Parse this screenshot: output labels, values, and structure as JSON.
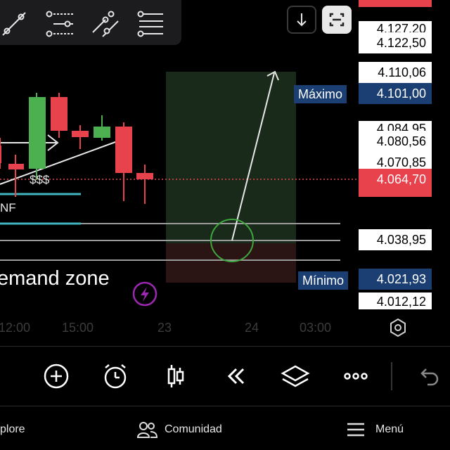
{
  "price_axis": {
    "labels": [
      "4.127,20",
      "4.122,50",
      "4.110,06",
      "4.101,00",
      "4.084,95",
      "4.080,56",
      "4.070,85",
      "4.064,70",
      "4.038,95",
      "4.021,93",
      "4.012,12"
    ],
    "max_tag": "Máximo",
    "min_tag": "Mínimo"
  },
  "time_axis": [
    "12:00",
    "15:00",
    "23",
    "24",
    "03:00"
  ],
  "chart": {
    "zone_label": "emand zone",
    "annotation_sss": "$$$",
    "annotation_nf": "NF"
  },
  "bottom_nav": {
    "explore": "plore",
    "community": "Comunidad",
    "menu": "Menú"
  },
  "colors": {
    "bull": "#4caf50",
    "bear": "#e8424d",
    "price_tag": "#1b3f72",
    "accent_purple": "#9c27b0"
  }
}
